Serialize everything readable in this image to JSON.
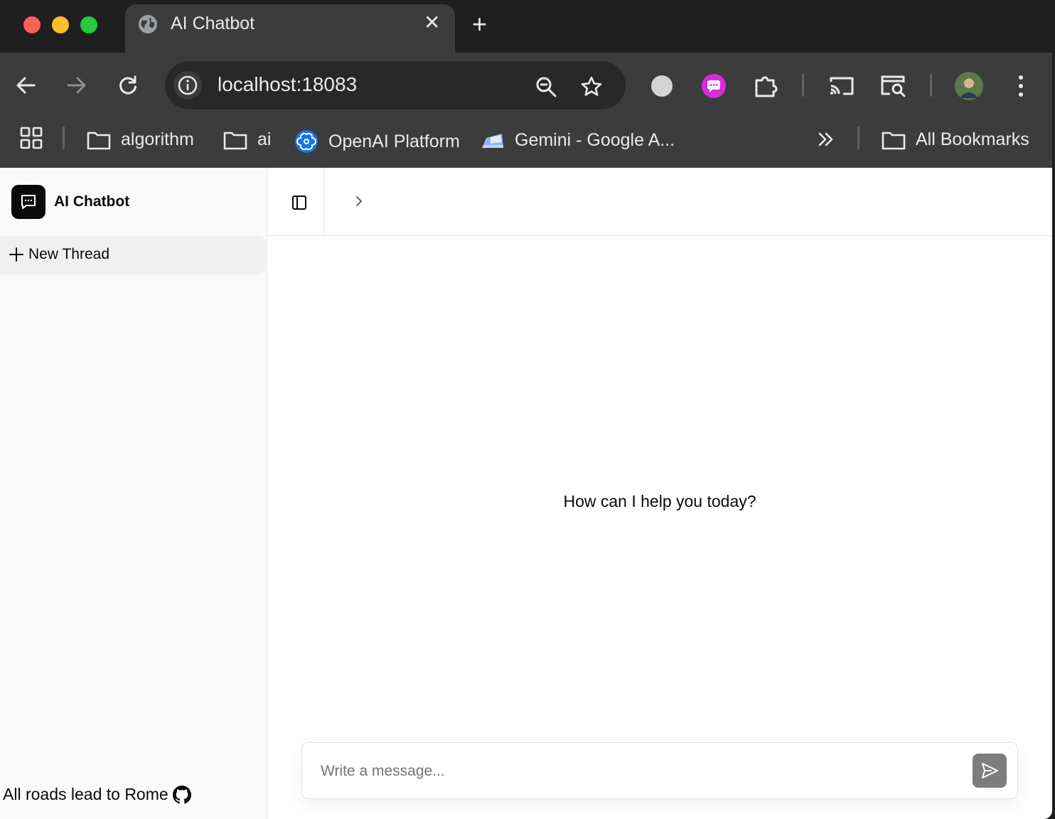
{
  "browser": {
    "tab": {
      "title": "AI Chatbot"
    },
    "address": {
      "url": "localhost:18083"
    },
    "bookmarks": [
      {
        "label": "algorithm",
        "icon": "folder-icon"
      },
      {
        "label": "ai",
        "icon": "folder-icon"
      },
      {
        "label": "OpenAI Platform",
        "icon": "openai-icon"
      },
      {
        "label": "Gemini - Google A...",
        "icon": "gemini-icon"
      }
    ],
    "all_bookmarks": "All Bookmarks"
  },
  "sidebar": {
    "app_title": "AI Chatbot",
    "new_thread": "New Thread",
    "footer_text": "All roads lead to Rome"
  },
  "main": {
    "welcome": "How can I help you today?",
    "composer": {
      "placeholder": "Write a message..."
    }
  }
}
